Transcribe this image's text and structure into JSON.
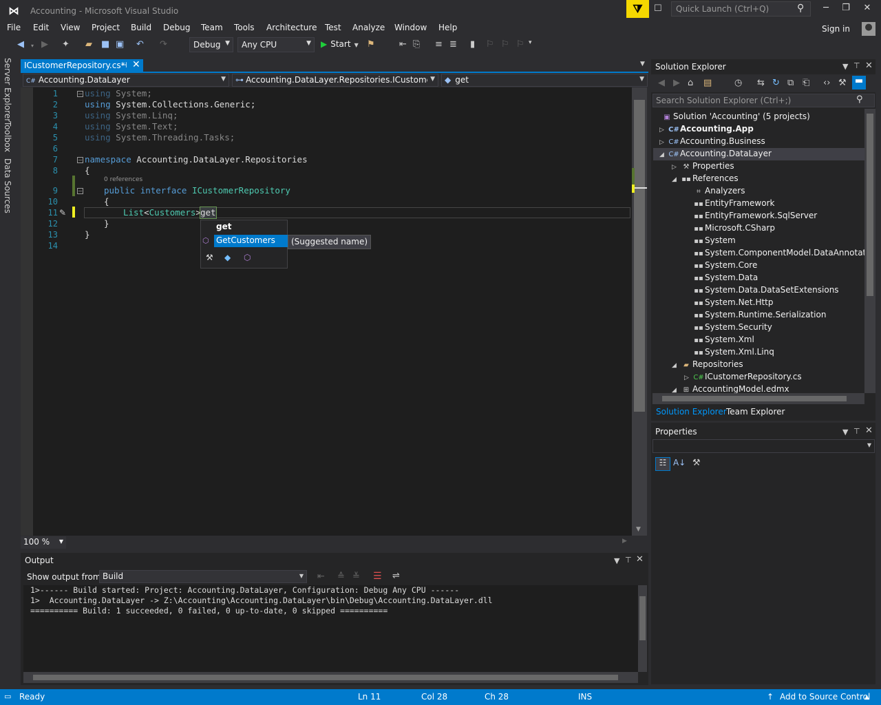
{
  "window": {
    "title": "Accounting - Microsoft Visual Studio",
    "quick_launch_placeholder": "Quick Launch (Ctrl+Q)",
    "sign_in": "Sign in"
  },
  "menu": [
    "File",
    "Edit",
    "View",
    "Project",
    "Build",
    "Debug",
    "Team",
    "Tools",
    "Architecture",
    "Test",
    "Analyze",
    "Window",
    "Help"
  ],
  "toolbar": {
    "configuration": "Debug",
    "platform": "Any CPU",
    "start_label": "Start"
  },
  "left_tabs": [
    "Server Explorer",
    "Toolbox",
    "Data Sources"
  ],
  "document_tab": {
    "label": "ICustomerRepository.cs*"
  },
  "navbar": {
    "project": "Accounting.DataLayer",
    "type": "Accounting.DataLayer.Repositories.ICustomerRepository",
    "member": "get"
  },
  "code": {
    "line_numbers": [
      "1",
      "2",
      "3",
      "4",
      "5",
      "6",
      "7",
      "8",
      "9",
      "10",
      "11",
      "12",
      "13",
      "14"
    ],
    "codelens": "0 references",
    "lines": {
      "l1": [
        "using",
        " System;"
      ],
      "l2": [
        "using",
        " System.Collections.Generic;"
      ],
      "l3": [
        "using",
        " System.Linq;"
      ],
      "l4": [
        "using",
        " System.Text;"
      ],
      "l5": [
        "using",
        " System.Threading.Tasks;"
      ],
      "l7": [
        "namespace",
        " Accounting.DataLayer.Repositories"
      ],
      "l8": "{",
      "l9": [
        "public",
        "interface",
        "ICustomerRepository"
      ],
      "l10": "{",
      "l11": [
        "List",
        "<",
        "Customers",
        ">",
        "get"
      ],
      "l12": "}",
      "l13": "}"
    }
  },
  "completion": {
    "typed": "get",
    "selected": "GetCustomers",
    "hint": "(Suggested name)"
  },
  "zoom": "100 %",
  "solution_explorer": {
    "title": "Solution Explorer",
    "search_placeholder": "Search Solution Explorer (Ctrl+;)",
    "nodes": [
      {
        "label": "Solution 'Accounting' (5 projects)"
      },
      {
        "label": "Accounting.App"
      },
      {
        "label": "Accounting.Business"
      },
      {
        "label": "Accounting.DataLayer"
      },
      {
        "label": "Properties"
      },
      {
        "label": "References"
      },
      {
        "label": "Analyzers"
      },
      {
        "label": "EntityFramework"
      },
      {
        "label": "EntityFramework.SqlServer"
      },
      {
        "label": "Microsoft.CSharp"
      },
      {
        "label": "System"
      },
      {
        "label": "System.ComponentModel.DataAnnotations"
      },
      {
        "label": "System.Core"
      },
      {
        "label": "System.Data"
      },
      {
        "label": "System.Data.DataSetExtensions"
      },
      {
        "label": "System.Net.Http"
      },
      {
        "label": "System.Runtime.Serialization"
      },
      {
        "label": "System.Security"
      },
      {
        "label": "System.Xml"
      },
      {
        "label": "System.Xml.Linq"
      },
      {
        "label": "Repositories"
      },
      {
        "label": "ICustomerRepository.cs"
      },
      {
        "label": "AccountingModel.edmx"
      }
    ],
    "tabs": [
      "Solution Explorer",
      "Team Explorer"
    ]
  },
  "properties": {
    "title": "Properties"
  },
  "output": {
    "title": "Output",
    "show_from_label": "Show output from:",
    "source": "Build",
    "lines": [
      "1>------ Build started: Project: Accounting.DataLayer, Configuration: Debug Any CPU ------",
      "1>  Accounting.DataLayer -> Z:\\Accounting\\Accounting.DataLayer\\bin\\Debug\\Accounting.DataLayer.dll",
      "========== Build: 1 succeeded, 0 failed, 0 up-to-date, 0 skipped =========="
    ]
  },
  "status": {
    "ready": "Ready",
    "ln": "Ln 11",
    "col": "Col 28",
    "ch": "Ch 28",
    "mode": "INS",
    "source_control": "Add to Source Control"
  },
  "colors": {
    "accent": "#007acc",
    "keyword": "#569cd6",
    "type": "#4ec9b0",
    "line_number": "#2b91af",
    "notification": "#f5d800"
  }
}
